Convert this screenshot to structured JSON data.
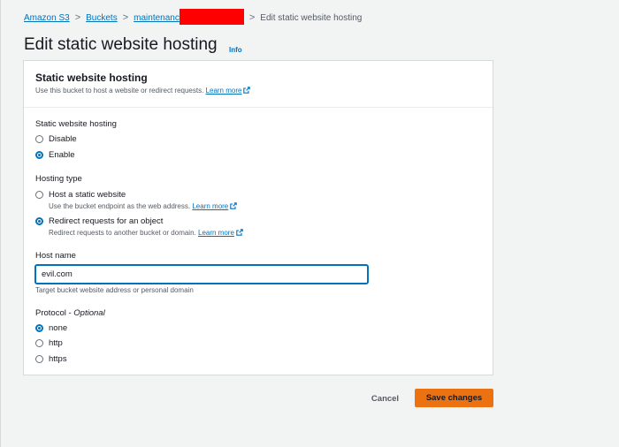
{
  "breadcrumb": {
    "items": [
      "Amazon S3",
      "Buckets",
      "maintenanc"
    ],
    "current": "Edit static website hosting",
    "separator": ">"
  },
  "page": {
    "title": "Edit static website hosting",
    "info_link": "Info"
  },
  "panel": {
    "title": "Static website hosting",
    "description": "Use this bucket to host a website or redirect requests.",
    "learn_more": "Learn more"
  },
  "hosting": {
    "label": "Static website hosting",
    "options": [
      "Disable",
      "Enable"
    ],
    "selected": "Enable"
  },
  "hosting_type": {
    "label": "Hosting type",
    "options": [
      {
        "label": "Host a static website",
        "description": "Use the bucket endpoint as the web address.",
        "learn_more": "Learn more"
      },
      {
        "label": "Redirect requests for an object",
        "description": "Redirect requests to another bucket or domain.",
        "learn_more": "Learn more"
      }
    ],
    "selected": "Redirect requests for an object"
  },
  "host_name": {
    "label": "Host name",
    "value": "evil.com",
    "hint": "Target bucket website address or personal domain"
  },
  "protocol": {
    "label": "Protocol - ",
    "optional": "Optional",
    "options": [
      "none",
      "http",
      "https"
    ],
    "selected": "none"
  },
  "actions": {
    "cancel": "Cancel",
    "save": "Save changes"
  },
  "colors": {
    "link": "#0073bb",
    "primary_button": "#ec7211",
    "redaction": "#ff0000",
    "background": "#f2f3f3"
  },
  "icons": {
    "external_link": "external-link-icon",
    "breadcrumb_separator": "chevron-right-icon"
  }
}
